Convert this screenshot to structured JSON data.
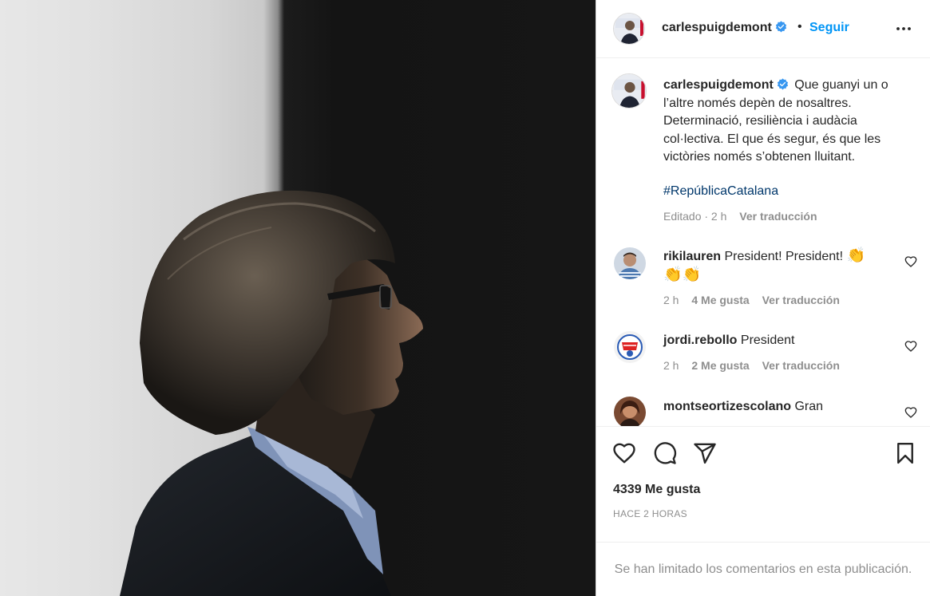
{
  "post": {
    "author": "carlespuigdemont",
    "follow_label": "Seguir",
    "dot": "•"
  },
  "caption": {
    "username": "carlespuigdemont",
    "text": "Que guanyi un o l’altre només depèn de nosaltres. Determinació, resiliència i audàcia col·lectiva. El que és segur, és que les victòries només s’obtenen lluitant.",
    "hashtag": "#RepúblicaCatalana",
    "edited": "Editado · 2 h",
    "translate": "Ver traducción"
  },
  "comments": [
    {
      "username": "rikilauren",
      "text": "President! President!",
      "emoji": "👏\n👏👏",
      "time": "2 h",
      "likes": "4 Me gusta",
      "translate": "Ver traducción"
    },
    {
      "username": "jordi.rebollo",
      "text": "President",
      "time": "2 h",
      "likes": "2 Me gusta",
      "translate": "Ver traducción"
    },
    {
      "username": "montseortizescolano",
      "text": "Gran"
    }
  ],
  "actions": {
    "likes_count": "4339 Me gusta",
    "posted": "HACE 2 HORAS",
    "comments_limited": "Se han limitado los comentarios en esta publicación."
  },
  "icons": [
    "verified-badge-icon",
    "more-options-icon",
    "heart-icon",
    "comment-icon",
    "share-icon",
    "save-icon"
  ],
  "colors": {
    "link_blue": "#0095f6",
    "hashtag": "#00376b",
    "muted": "#8e8e8e",
    "verified": "#3897f0"
  }
}
